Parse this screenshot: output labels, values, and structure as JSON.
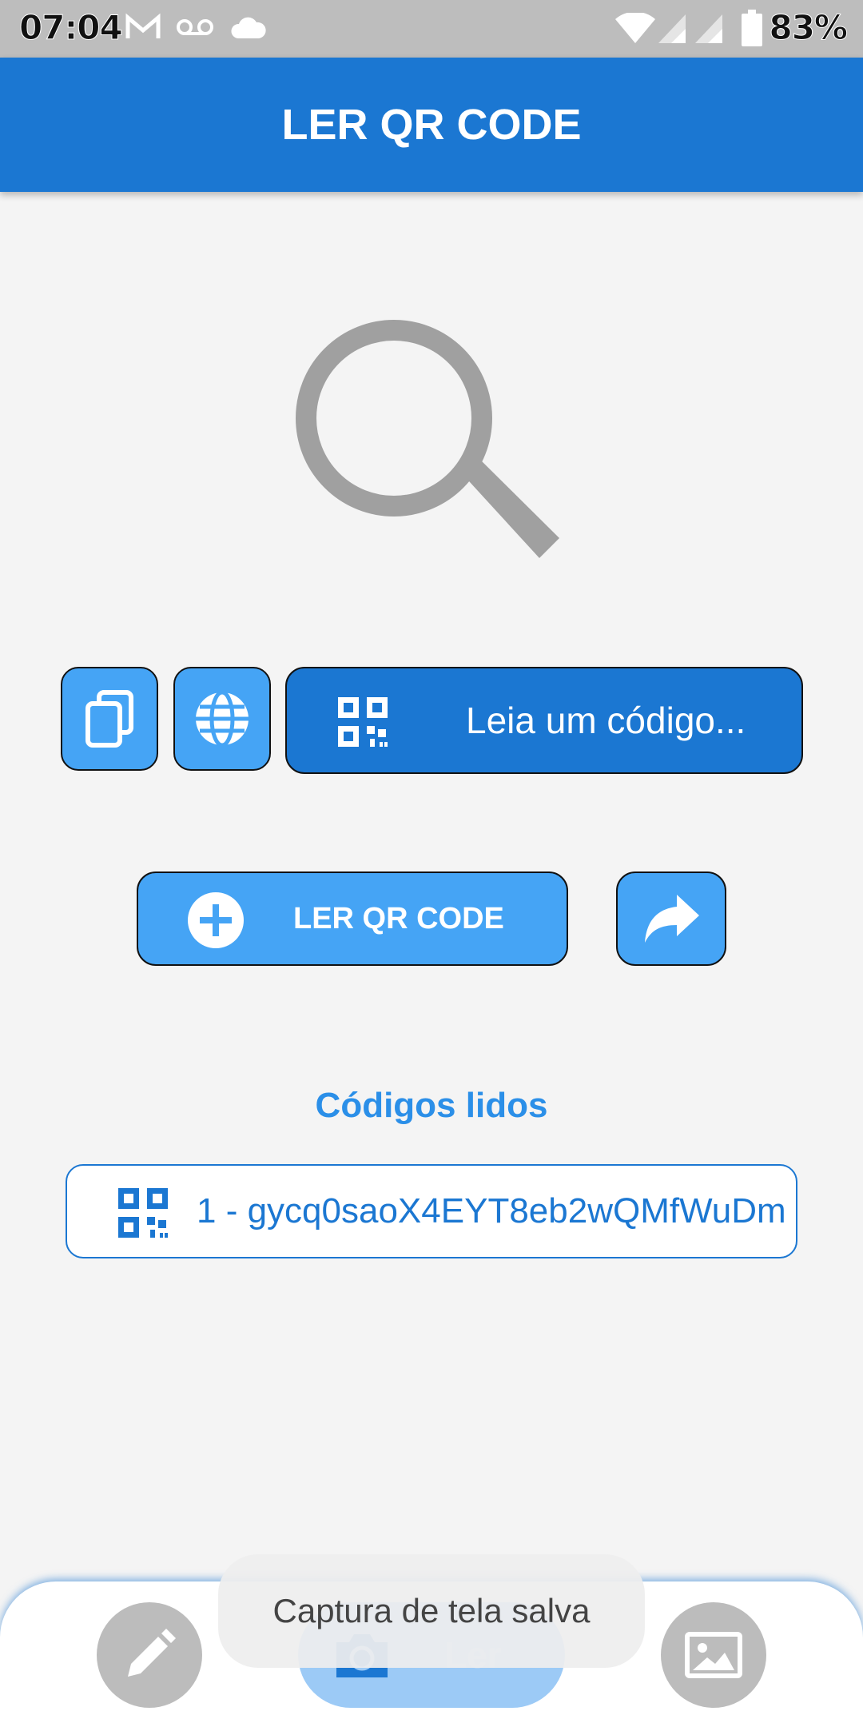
{
  "status_bar": {
    "time": "07:04",
    "battery": "83%",
    "icons": [
      "gmail-icon",
      "voicemail-icon",
      "cloud-icon",
      "wifi-icon",
      "signal-icon",
      "signal-icon",
      "battery-icon"
    ]
  },
  "app_bar": {
    "title": "LER QR CODE"
  },
  "actions": {
    "copy_icon": "copy-icon",
    "web_icon": "globe-icon",
    "read_label": "Leia um código..."
  },
  "scan": {
    "button_label": "LER QR CODE",
    "share_icon": "share-icon"
  },
  "history": {
    "title": "Códigos lidos",
    "items": [
      {
        "text": "1 - gycq0saoX4EYT8eb2wQMfWuDm"
      }
    ]
  },
  "bottom_nav": {
    "left_icon": "pencil-icon",
    "center_label": "Ler",
    "right_icon": "image-icon"
  },
  "toast": {
    "text": "Captura de tela salva"
  },
  "colors": {
    "primary": "#1b77d2",
    "light_blue": "#45a4f5",
    "background": "#f4f4f4",
    "accent_text": "#2b8fe8"
  }
}
